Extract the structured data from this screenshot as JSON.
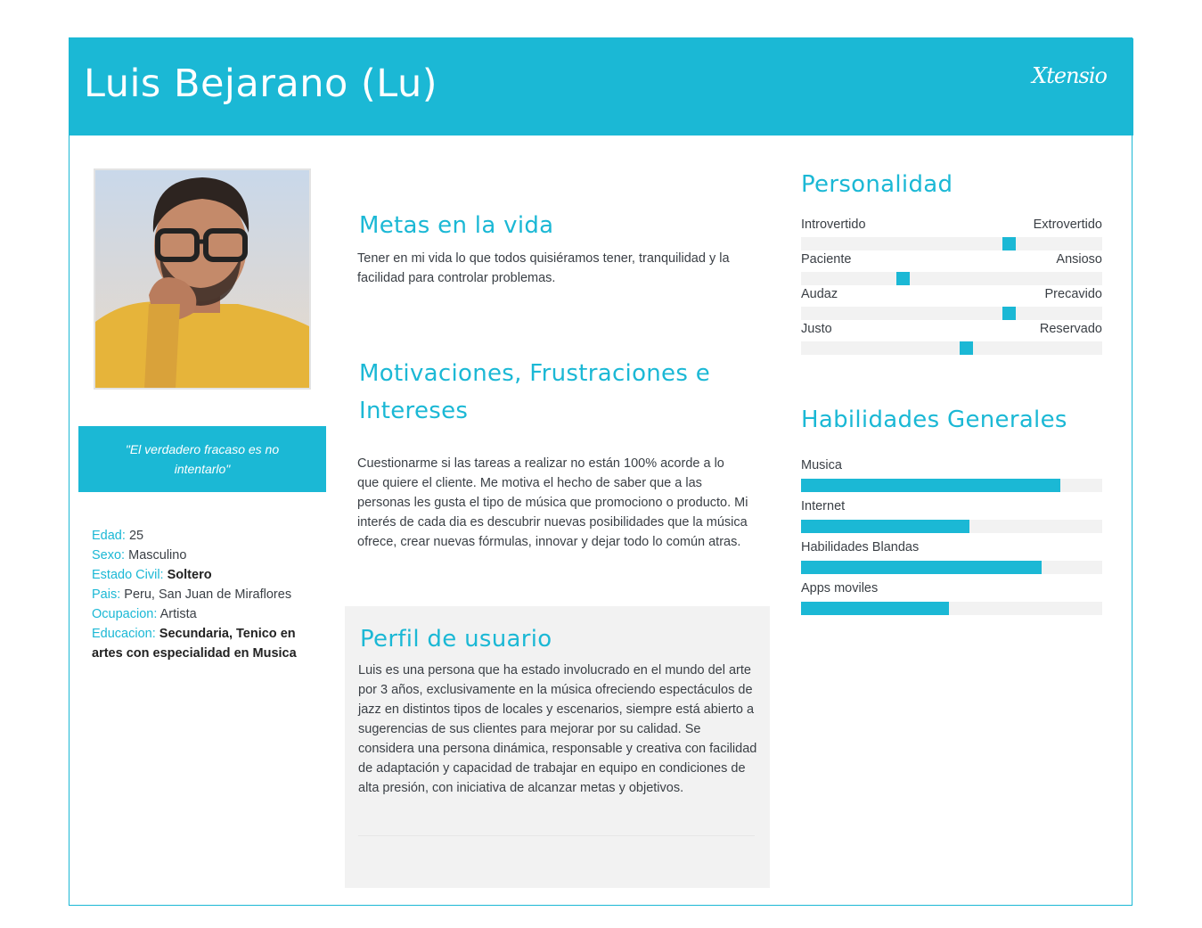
{
  "header": {
    "title": "Luis Bejarano (Lu)",
    "logo": "Xtensio"
  },
  "quote": "\"El verdadero fracaso es no intentarlo\"",
  "demographics": {
    "edad_label": "Edad:",
    "edad": "25",
    "sexo_label": "Sexo:",
    "sexo": "Masculino",
    "estado_label": "Estado Civil:",
    "estado": "Soltero",
    "pais_label": "Pais:",
    "pais": "Peru, San Juan de Miraflores",
    "ocupacion_label": "Ocupacion:",
    "ocupacion": "Artista",
    "educacion_label": "Educacion:",
    "educacion": "Secundaria, Tenico en artes con especialidad en Musica"
  },
  "goals": {
    "title": "Metas en la vida",
    "text": "Tener en mi vida lo que todos quisiéramos tener, tranquilidad y la facilidad para controlar problemas."
  },
  "motivations": {
    "title_line1": "Motivaciones, Frustraciones e",
    "title_line2": "Intereses",
    "text": "Cuestionarme si las tareas a realizar no están 100% acorde a lo que quiere el cliente. Me motiva el hecho de saber que a las personas les gusta el tipo de música que promociono o producto.  Mi interés de cada dia es descubrir nuevas posibilidades que la música ofrece, crear nuevas fórmulas, innovar y dejar todo lo común atras."
  },
  "profile": {
    "title": "Perfil de usuario",
    "text": "Luis es una persona que ha estado involucrado en el mundo del arte por 3 años, exclusivamente en la música ofreciendo espectáculos de jazz en distintos tipos de locales y escenarios, siempre está abierto a sugerencias de sus clientes para mejorar por su calidad. Se considera una persona dinámica, responsable y creativa con facilidad de adaptación y capacidad de trabajar en equipo en condiciones de alta presión, con iniciativa de alcanzar metas y objetivos."
  },
  "personality": {
    "title": "Personalidad",
    "traits": [
      {
        "left": "Introvertido",
        "right": "Extrovertido",
        "level": 0.69
      },
      {
        "left": "Paciente",
        "right": "Ansioso",
        "level": 0.34
      },
      {
        "left": "Audaz",
        "right": "Precavido",
        "level": 0.69
      },
      {
        "left": "Justo",
        "right": "Reservado",
        "level": 0.55
      }
    ]
  },
  "skills": {
    "title": "Habilidades Generales",
    "items": [
      {
        "label": "Musica",
        "level": 0.86
      },
      {
        "label": "Internet",
        "level": 0.56
      },
      {
        "label": "Habilidades Blandas",
        "level": 0.8
      },
      {
        "label": "Apps moviles",
        "level": 0.49
      }
    ]
  },
  "colors": {
    "accent": "#1bb8d5",
    "track": "#f2f2f2",
    "text": "#3a3f45"
  }
}
